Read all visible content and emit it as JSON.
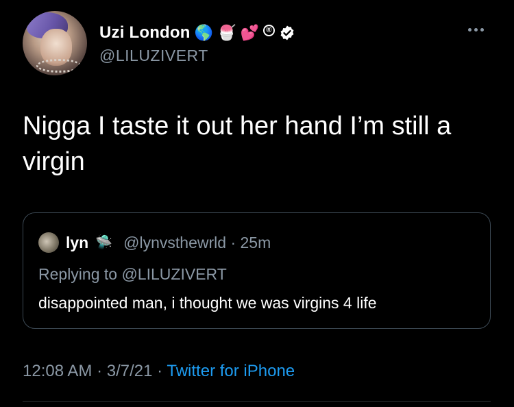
{
  "tweet": {
    "author": {
      "name": "Uzi London",
      "handle": "@LILUZIVERT",
      "emojis": [
        "🌎",
        "🍧",
        "💕"
      ],
      "reg_mark": "®"
    },
    "text": "Nigga I taste it out her hand I’m still a virgin",
    "quote": {
      "name": "lyn",
      "name_emoji": "🛸",
      "handle": "@lynvsthewrld",
      "separator": "·",
      "time": "25m",
      "replying_to": "Replying to @LILUZIVERT",
      "text": "disappointed man, i thought we was virgins 4 life"
    },
    "meta": {
      "time": "12:08 AM",
      "separator": "·",
      "date": "3/7/21",
      "separator2": "·",
      "source": "Twitter for iPhone"
    }
  },
  "colors": {
    "background": "#000000",
    "secondary_text": "#8b98a5",
    "link": "#1d9bf0",
    "border": "#3d4a55"
  }
}
